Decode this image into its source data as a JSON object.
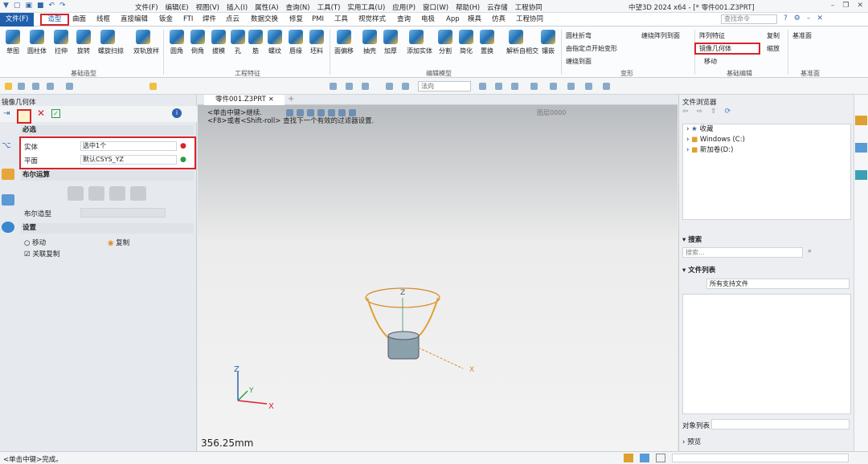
{
  "app": {
    "title": "中望3D 2024 x64 - [* 零件001.Z3PRT]"
  },
  "menus": [
    "文件(F)",
    "编辑(E)",
    "视图(V)",
    "插入(I)",
    "属性(A)",
    "查询(N)",
    "工具(T)",
    "实用工具(U)",
    "应用(P)",
    "窗口(W)",
    "帮助(H)",
    "云存储",
    "工程协同"
  ],
  "tabs": [
    "文件(F)",
    "造型",
    "曲面",
    "线框",
    "直接编辑",
    "钣金",
    "FTI",
    "焊件",
    "点云",
    "数据交换",
    "修复",
    "PMI",
    "工具",
    "视觉样式",
    "查询",
    "电极",
    "App",
    "模具",
    "仿真",
    "工程协同"
  ],
  "search": {
    "placeholder": "查找命令"
  },
  "ribbon": {
    "groups": [
      "基础造型",
      "工程特征",
      "编辑模型",
      "变形",
      "基础编辑",
      "基准面"
    ],
    "basic": [
      "草图",
      "圆柱体",
      "拉伸",
      "旋转",
      "螺旋扫掠",
      "双轨放样"
    ],
    "eng": [
      "圆角",
      "倒角",
      "拔模",
      "孔",
      "筋",
      "螺纹",
      "唇缘",
      "坯料"
    ],
    "edit": [
      "面偏移",
      "抽壳",
      "加厚",
      "添加实体",
      "分割",
      "简化",
      "置换",
      "解析自相交",
      "镶嵌"
    ],
    "deform": [
      "圆柱折弯",
      "由指定点开始变形",
      "缠绕到面",
      "缠绕阵列到面"
    ],
    "basicedit": [
      "阵列特征",
      "复制",
      "镜像几何体",
      "缩放",
      "移动"
    ],
    "datum": [
      "基准面"
    ]
  },
  "filter": {
    "value": "法向"
  },
  "doc": {
    "tab": "零件001.Z3PRT",
    "hint1": "<单击中键>继续.",
    "hint2": "<F8>或者<Shift-roll> 查找下一个有效的过滤器设置.",
    "layer": "图层0000",
    "scale": "356.25mm"
  },
  "left": {
    "title": "镜像几何体",
    "required": "必选",
    "entity_label": "实体",
    "entity_value": "选中1个",
    "plane_label": "平面",
    "plane_value": "默认CSYS_YZ",
    "boolean": "布尔运算",
    "boolean_label": "布尔造型",
    "settings": "设置",
    "move": "移动",
    "copy": "复制",
    "assoc": "关联复制"
  },
  "right": {
    "title": "文件浏览器",
    "tree": [
      "收藏",
      "Windows (C:)",
      "新加卷(D:)"
    ],
    "search": "搜索",
    "search_ph": "搜索...",
    "filelist": "文件列表",
    "filter": "所有支持文件",
    "objlist": "对象列表",
    "preview": "预览"
  },
  "status": {
    "text": "<单击中键>完成。"
  }
}
